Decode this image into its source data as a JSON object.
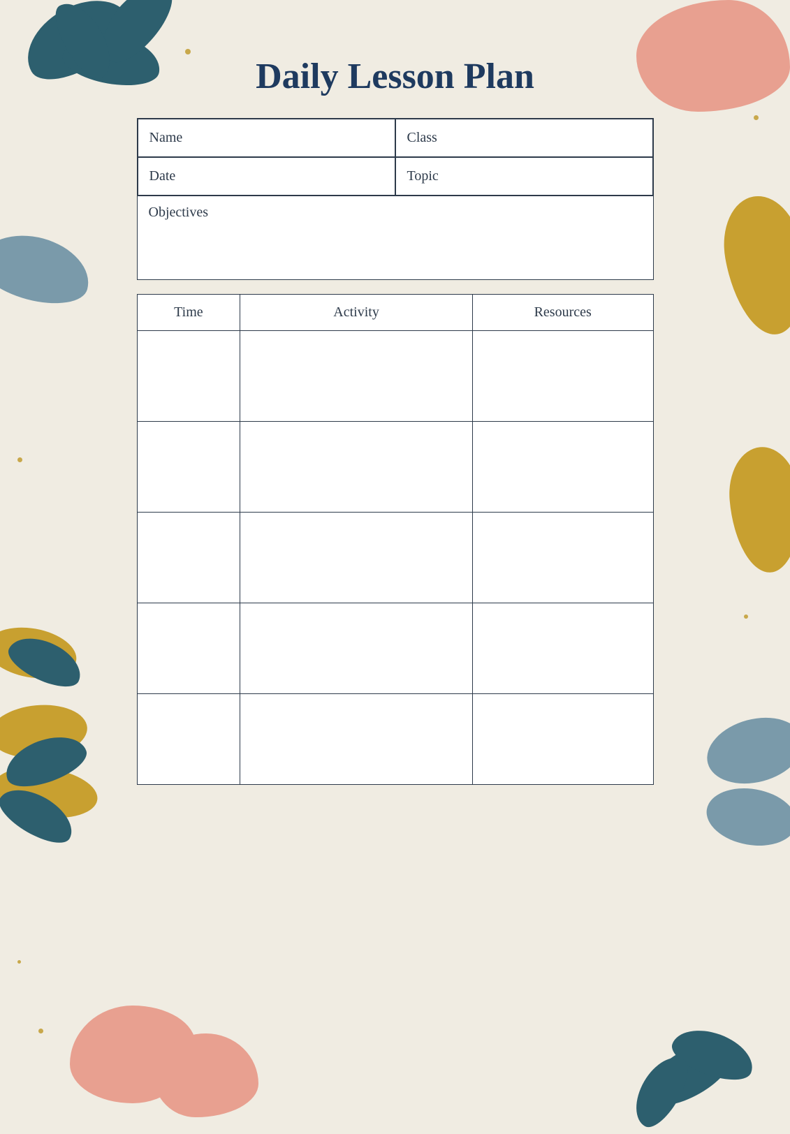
{
  "page": {
    "title": "Daily Lesson Plan",
    "background_color": "#f0ece2"
  },
  "form": {
    "name_label": "Name",
    "class_label": "Class",
    "date_label": "Date",
    "topic_label": "Topic",
    "objectives_label": "Objectives"
  },
  "table": {
    "headers": [
      "Time",
      "Activity",
      "Resources"
    ],
    "rows": 5
  },
  "decorations": {
    "accent_teal": "#2d5f6e",
    "accent_pink": "#e8a090",
    "accent_gold": "#c8a030",
    "accent_slate": "#7a9aaa",
    "dot_color": "#c8a84b"
  }
}
